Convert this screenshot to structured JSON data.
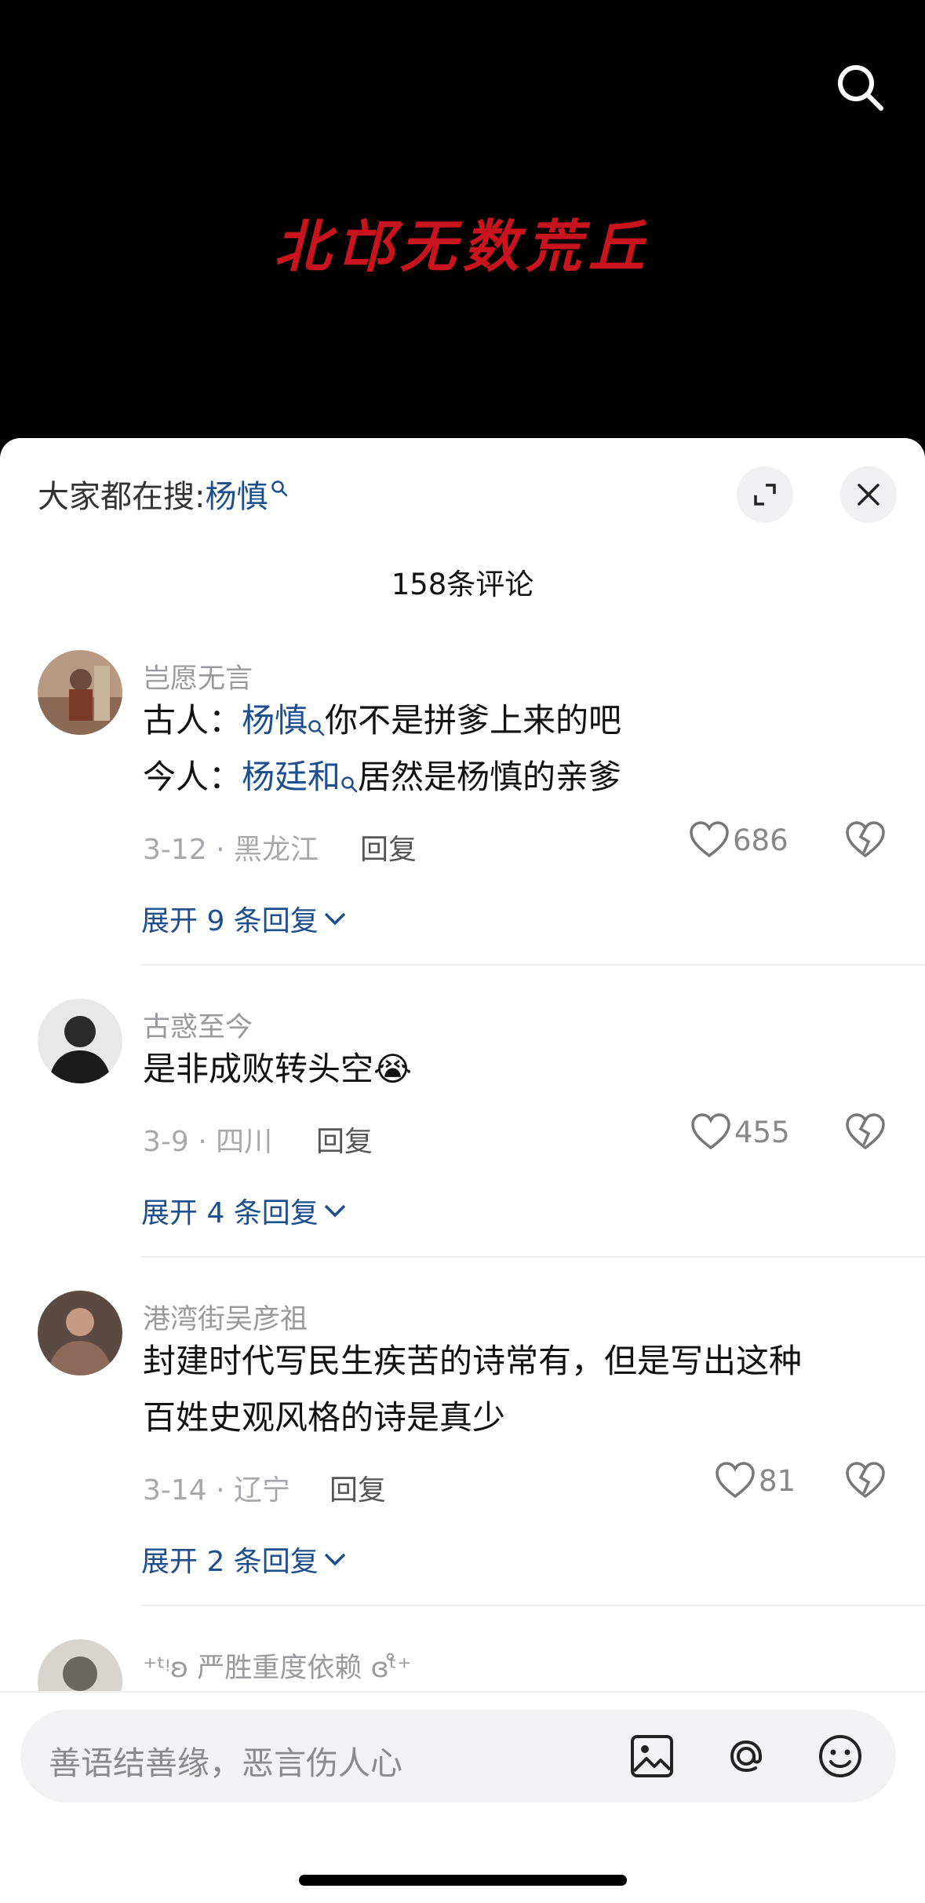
{
  "video": {
    "title": "北邙无数荒丘"
  },
  "header": {
    "hot_search_prefix": "大家都在搜:",
    "hot_search_keyword": "杨慎",
    "comment_count": "158条评论"
  },
  "comments": [
    {
      "username": "岂愿无言",
      "line1_prefix": "古人：",
      "line1_link": "杨慎",
      "line1_rest": "你不是拼爹上来的吧",
      "line2_prefix": "今人：",
      "line2_link": "杨廷和",
      "line2_rest": "居然是杨慎的亲爹",
      "meta": "3-12 · 黑龙江",
      "reply_label": "回复",
      "likes": "686",
      "expand": "展开 9 条回复"
    },
    {
      "username": "古惑至今",
      "text": "是非成败转头空",
      "emoji": "😭",
      "meta": "3-9 · 四川",
      "reply_label": "回复",
      "likes": "455",
      "expand": "展开 4 条回复"
    },
    {
      "username": "港湾街吴彦祖",
      "line1": "封建时代写民生疾苦的诗常有，但是写出这种",
      "line2": "百姓史观风格的诗是真少",
      "meta": "3-14 · 辽宁",
      "reply_label": "回复",
      "likes": "81",
      "expand": "展开 2 条回复"
    },
    {
      "username": "⁺ᵗᵎʚ 严胜重度依赖 ɞᵗ̊⁺"
    }
  ],
  "input": {
    "placeholder": "善语结善缘，恶言伤人心"
  },
  "icons": [
    "search-icon",
    "expand-icon",
    "close-icon",
    "heart-icon",
    "broken-heart-icon",
    "chevron-down-icon",
    "image-icon",
    "at-icon",
    "emoji-icon"
  ],
  "colors": {
    "accent": "#1d4f8f",
    "title_red": "#c8141e"
  }
}
